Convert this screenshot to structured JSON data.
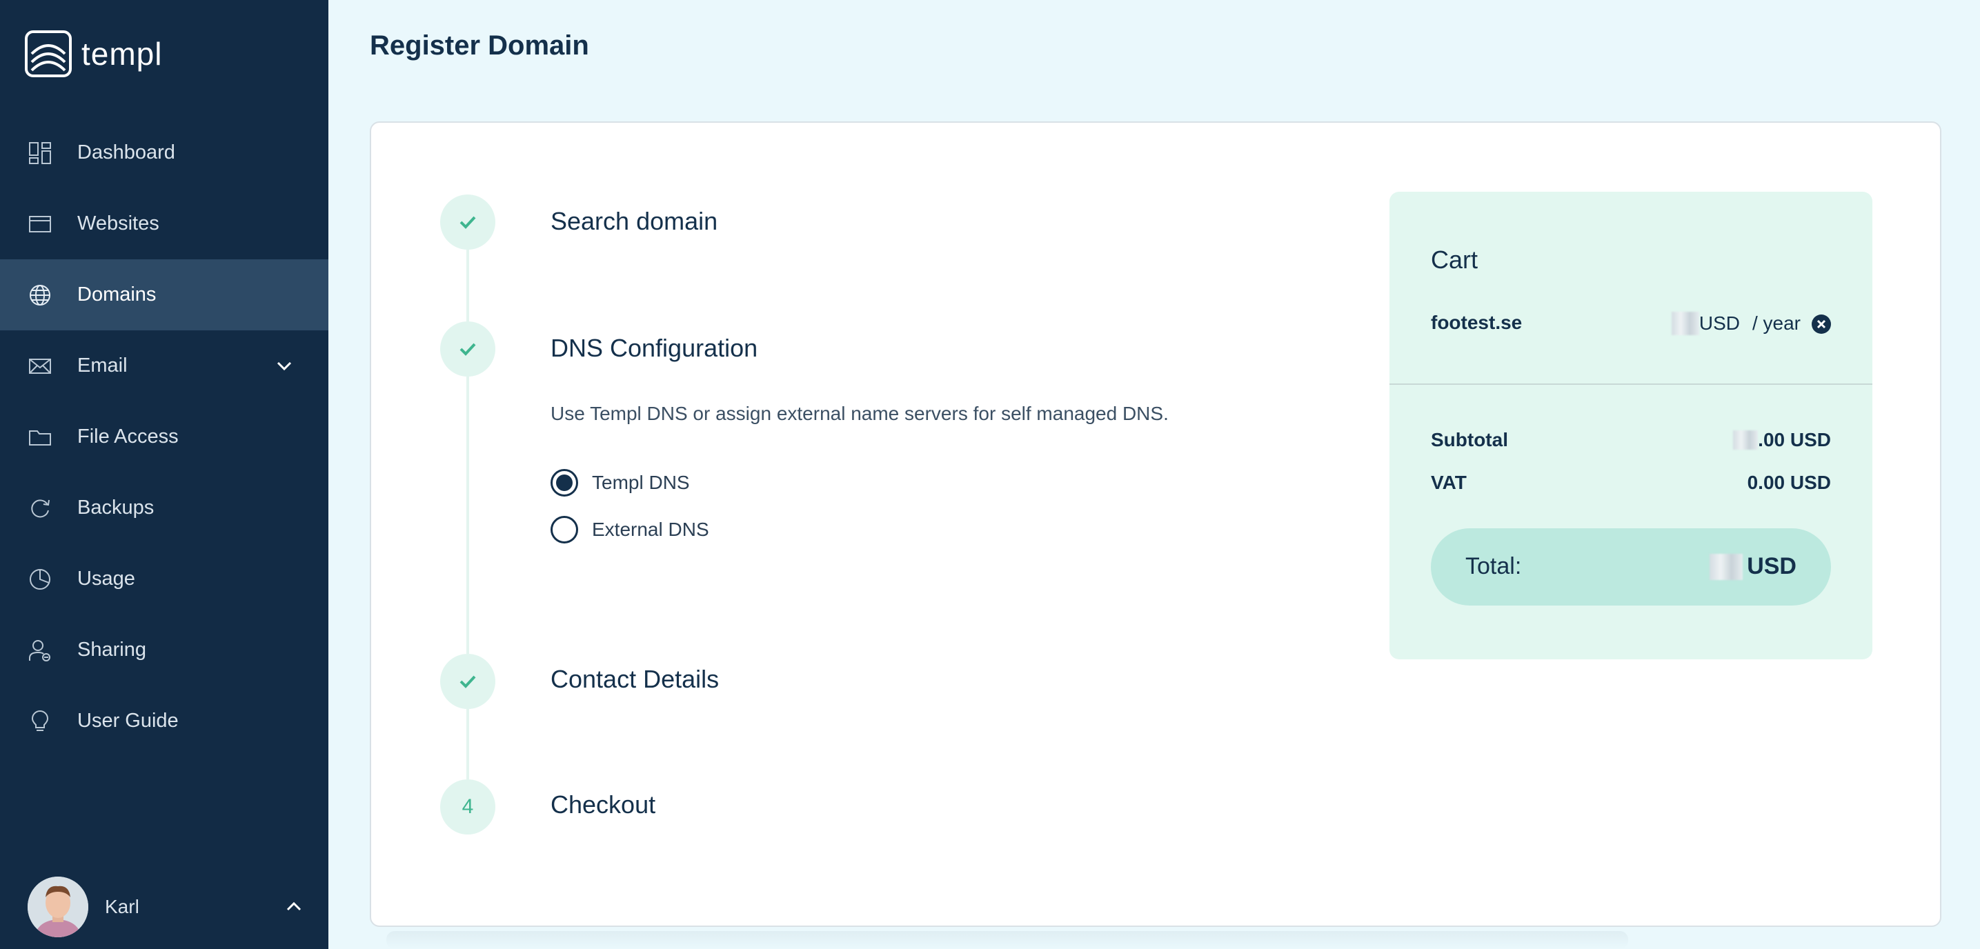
{
  "app": {
    "brand": "templ"
  },
  "sidebar": {
    "items": [
      {
        "label": "Dashboard",
        "icon": "dashboard-icon"
      },
      {
        "label": "Websites",
        "icon": "browser-window-icon"
      },
      {
        "label": "Domains",
        "icon": "globe-icon",
        "active": true
      },
      {
        "label": "Email",
        "icon": "envelope-icon",
        "expandable": true
      },
      {
        "label": "File Access",
        "icon": "folder-icon"
      },
      {
        "label": "Backups",
        "icon": "refresh-icon"
      },
      {
        "label": "Usage",
        "icon": "pie-chart-icon"
      },
      {
        "label": "Sharing",
        "icon": "user-share-icon"
      },
      {
        "label": "User Guide",
        "icon": "lightbulb-icon"
      }
    ],
    "user": {
      "name": "Karl"
    }
  },
  "page": {
    "title": "Register Domain"
  },
  "steps": [
    {
      "title": "Search domain",
      "status": "done"
    },
    {
      "title": "DNS Configuration",
      "status": "done",
      "description": "Use Templ DNS or assign external name servers for self managed DNS."
    },
    {
      "title": "Contact Details",
      "status": "done"
    },
    {
      "title": "Checkout",
      "status": "current",
      "number": "4"
    }
  ],
  "dns_options": [
    {
      "label": "Templ DNS",
      "selected": true
    },
    {
      "label": "External DNS",
      "selected": false
    }
  ],
  "cart": {
    "title": "Cart",
    "item": {
      "domain": "footest.se",
      "currency": "USD",
      "period": "/ year"
    },
    "subtotal_label": "Subtotal",
    "subtotal_value": ".00 USD",
    "vat_label": "VAT",
    "vat_value": "0.00 USD",
    "total_label": "Total:",
    "total_value": "USD"
  },
  "colors": {
    "sidebar": "#122b45",
    "active": "#2d4a66",
    "accent": "#3fb58f",
    "background": "#eaf8fc",
    "cart": "#e2f7f0"
  }
}
